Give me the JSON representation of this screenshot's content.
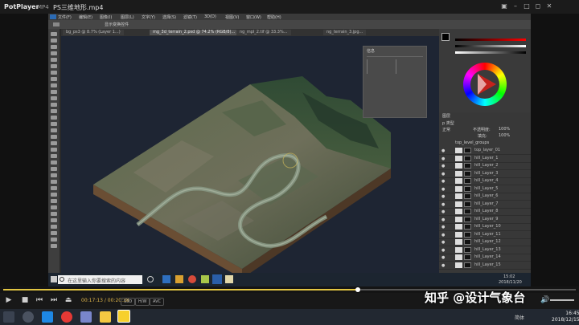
{
  "player": {
    "app_name": "PotPlayer",
    "format": "MP4",
    "file_name": "PS三维地形.mp4",
    "time_current": "00:17:13",
    "time_total": "00:20:38",
    "btn_320": "S3D",
    "btn_eq": "H/W",
    "btn_ctrl": "AVC",
    "progress": 0.62
  },
  "photoshop": {
    "menu": [
      "文件(F)",
      "编辑(E)",
      "图像(I)",
      "图层(L)",
      "文字(Y)",
      "选择(S)",
      "滤镜(T)",
      "3D(D)",
      "视图(V)",
      "窗口(W)",
      "帮助(H)"
    ],
    "option_label": "显示变换控件",
    "tabs": [
      {
        "label": "bg_ps3 @ 8.7% (Layer 1...)",
        "active": false
      },
      {
        "label": "mg_3d_terrain_2.psd @ 74.2% (RGB/8)...",
        "active": true
      },
      {
        "label": "ng_mpl_2.tif @ 33.3%...",
        "active": false
      },
      {
        "label": "ng_terrain_3.jpg...",
        "active": false
      }
    ],
    "info_title": "信息",
    "layers_tab": "图层",
    "layers_kind": "p 类型",
    "blend_mode": "正常",
    "opacity_label": "不透明度:",
    "opacity_value": "100%",
    "fill_label": "填充:",
    "fill_value": "100%",
    "group_name": "top_level_groups",
    "layers": [
      "top_layer_01",
      "hill_Layer_1",
      "hill_Layer_2",
      "hill_Layer_3",
      "hill_Layer_4",
      "hill_Layer_5",
      "hill_Layer_6",
      "hill_Layer_7",
      "hill_Layer_8",
      "hill_Layer_9",
      "hill_Layer_10",
      "hill_Layer_11",
      "hill_Layer_12",
      "hill_Layer_13",
      "hill_Layer_14",
      "hill_Layer_15"
    ]
  },
  "inner_taskbar": {
    "search_placeholder": "在这里输入你要搜索的内容",
    "time": "15:02",
    "date": "2018/11/20"
  },
  "taskbar": {
    "time": "16:45",
    "date": "2018/12/15",
    "lang": "简体"
  },
  "watermark": "知乎 @设计气象台",
  "colors": {
    "accent_progress": "#e2c542",
    "ps_bg": "#3c3c3c",
    "canvas_bg": "#1e2533"
  }
}
